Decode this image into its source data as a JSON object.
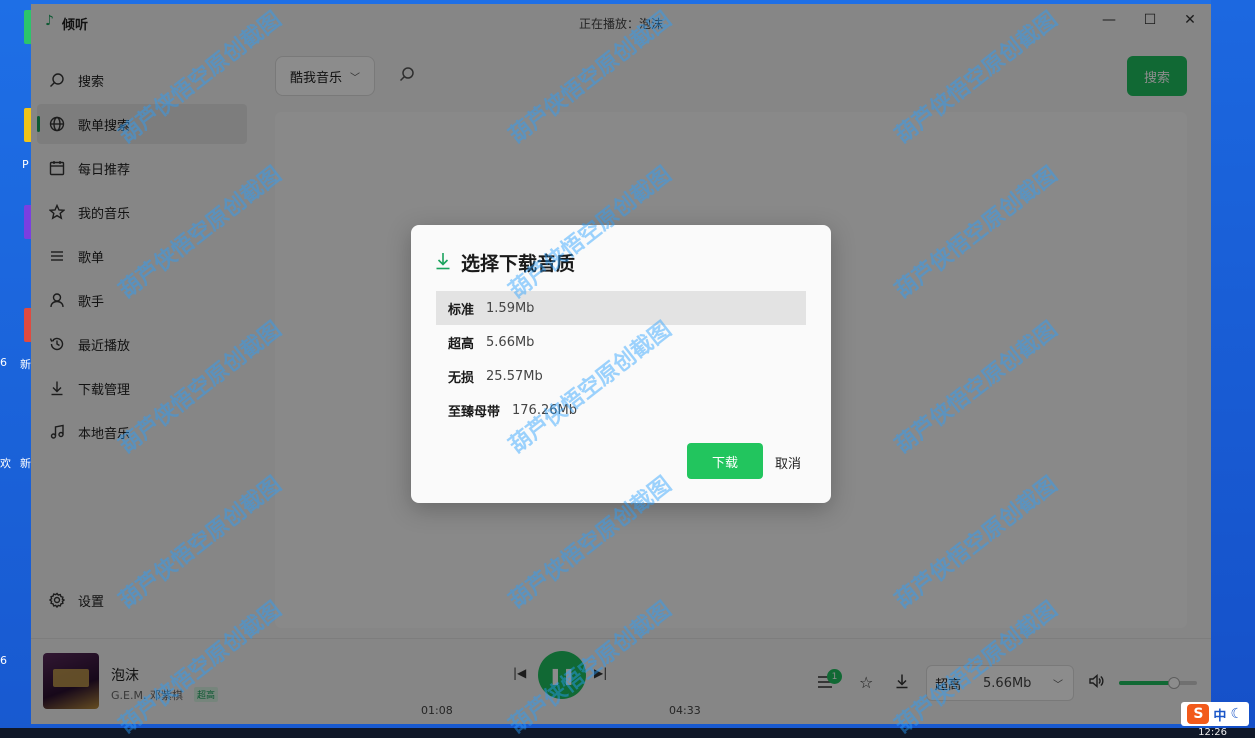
{
  "window": {
    "app_title": "倾听",
    "now_playing": "正在播放：泡沫"
  },
  "desktop": {
    "edge_labels": [
      "P",
      "6",
      "新",
      "欢",
      "新",
      "6"
    ]
  },
  "sidebar": {
    "items": [
      {
        "label": "搜索",
        "icon": "search-icon"
      },
      {
        "label": "歌单搜索",
        "icon": "globe-icon",
        "active": true
      },
      {
        "label": "每日推荐",
        "icon": "calendar-icon"
      },
      {
        "label": "我的音乐",
        "icon": "star-icon"
      },
      {
        "label": "歌单",
        "icon": "list-icon"
      },
      {
        "label": "歌手",
        "icon": "user-icon"
      },
      {
        "label": "最近播放",
        "icon": "history-icon"
      },
      {
        "label": "下载管理",
        "icon": "download-icon"
      },
      {
        "label": "本地音乐",
        "icon": "music-note-icon"
      }
    ],
    "settings_label": "设置"
  },
  "search": {
    "source": "酷我音乐",
    "placeholder": "",
    "button_label": "搜索"
  },
  "player": {
    "song_title": "泡沫",
    "artist": "G.E.M. 邓紫棋",
    "quality_tag": "超高",
    "current_time": "01:08",
    "total_time": "04:33",
    "playlist_count": "1",
    "quality_label": "超高",
    "quality_size": "5.66Mb",
    "volume_percent": 70,
    "accent_color": "#1fbf5f"
  },
  "modal": {
    "title": "选择下载音质",
    "options": [
      {
        "label": "标准",
        "size": "1.59Mb",
        "selected": true
      },
      {
        "label": "超高",
        "size": "5.66Mb"
      },
      {
        "label": "无损",
        "size": "25.57Mb"
      },
      {
        "label": "至臻母带",
        "size": "176.26Mb"
      }
    ],
    "download_label": "下载",
    "cancel_label": "取消"
  },
  "watermark": "葫芦侠悟空原创截图",
  "tray": {
    "ime_zh": "中",
    "clock": "12:26"
  }
}
